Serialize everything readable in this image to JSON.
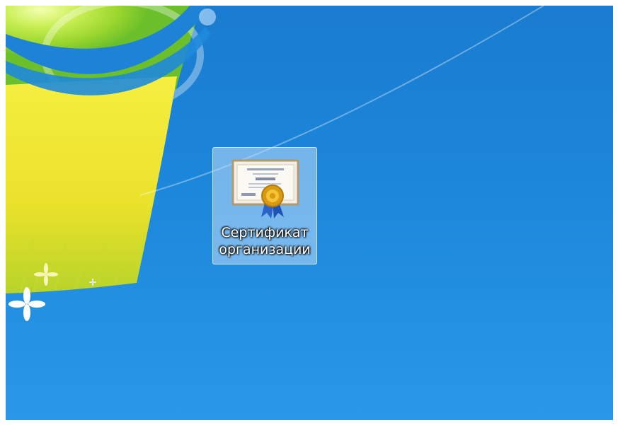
{
  "desktop": {
    "background_color": "#1c86da",
    "icons": [
      {
        "label_line1": "Сертификат",
        "label_line2": "организации",
        "icon": "certificate-icon",
        "selected": true
      }
    ]
  }
}
